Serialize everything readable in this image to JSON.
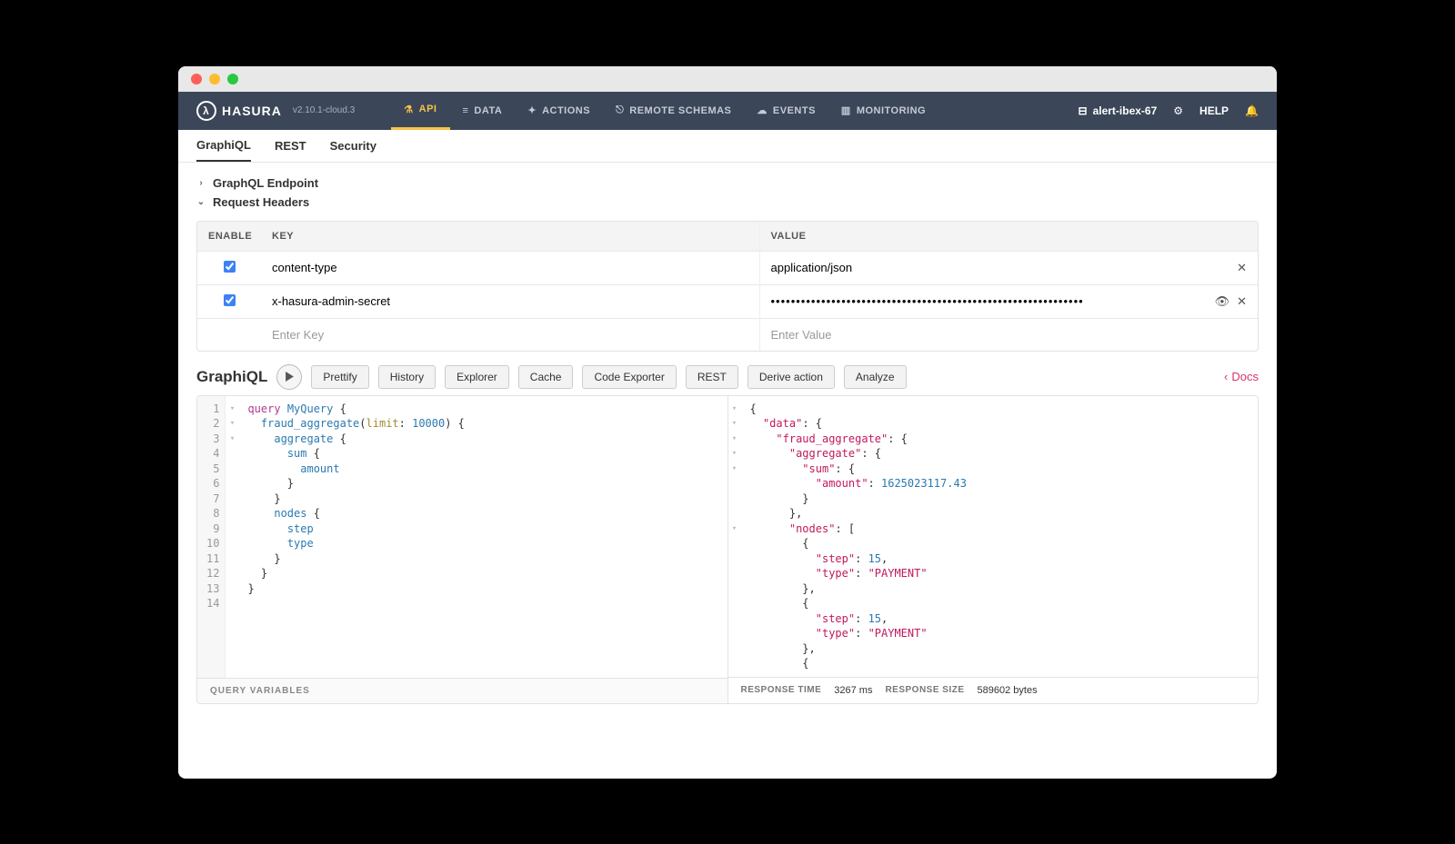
{
  "brand": "HASURA",
  "version": "v2.10.1-cloud.3",
  "nav": {
    "api": "API",
    "data": "DATA",
    "actions": "ACTIONS",
    "remote": "REMOTE SCHEMAS",
    "events": "EVENTS",
    "monitoring": "MONITORING"
  },
  "project": "alert-ibex-67",
  "help": "HELP",
  "subtabs": {
    "graphiql": "GraphiQL",
    "rest": "REST",
    "security": "Security"
  },
  "sections": {
    "endpoint": "GraphQL Endpoint",
    "headers": "Request Headers"
  },
  "headers": {
    "cols": {
      "enable": "ENABLE",
      "key": "KEY",
      "value": "VALUE"
    },
    "rows": [
      {
        "key": "content-type",
        "value": "application/json",
        "masked": false
      },
      {
        "key": "x-hasura-admin-secret",
        "value": "••••••••••••••••••••••••••••••••••••••••••••••••••••••••••••••",
        "masked": true
      }
    ],
    "placeholders": {
      "key": "Enter Key",
      "value": "Enter Value"
    }
  },
  "graphiql": {
    "title": "GraphiQL",
    "buttons": {
      "prettify": "Prettify",
      "history": "History",
      "explorer": "Explorer",
      "cache": "Cache",
      "codeexporter": "Code Exporter",
      "rest": "REST",
      "derive": "Derive action",
      "analyze": "Analyze"
    },
    "docs": "Docs",
    "vars": "QUERY VARIABLES"
  },
  "query_lines": 14,
  "result": {
    "amount": "1625023117.43",
    "step1": "15",
    "type1": "\"PAYMENT\"",
    "step2": "15",
    "type2": "\"PAYMENT\""
  },
  "status": {
    "rt_lbl": "RESPONSE TIME",
    "rt_val": "3267 ms",
    "rs_lbl": "RESPONSE SIZE",
    "rs_val": "589602 bytes"
  }
}
